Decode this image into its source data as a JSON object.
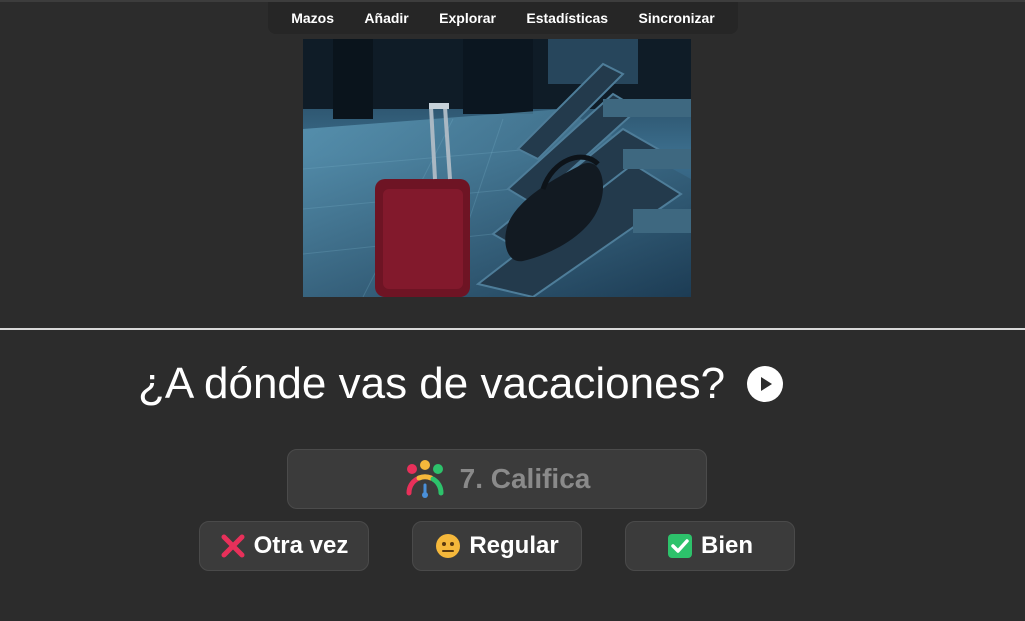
{
  "nav": {
    "items": [
      {
        "label": "Mazos"
      },
      {
        "label": "Añadir"
      },
      {
        "label": "Explorar"
      },
      {
        "label": "Estadísticas"
      },
      {
        "label": "Sincronizar"
      }
    ]
  },
  "card": {
    "image_icon": "airport-luggage-photo",
    "question": "¿A dónde vas de vacaciones?",
    "audio_icon": "play-icon"
  },
  "rating": {
    "icon": "rating-gauge-icon",
    "label": "7. Califica"
  },
  "answers": [
    {
      "label": "Otra vez",
      "icon": "red-x-icon",
      "color": "#e8305a"
    },
    {
      "label": "Regular",
      "icon": "neutral-face-icon",
      "color": "#f5b83b"
    },
    {
      "label": "Bien",
      "icon": "check-box-icon",
      "color": "#2dc26b"
    }
  ]
}
